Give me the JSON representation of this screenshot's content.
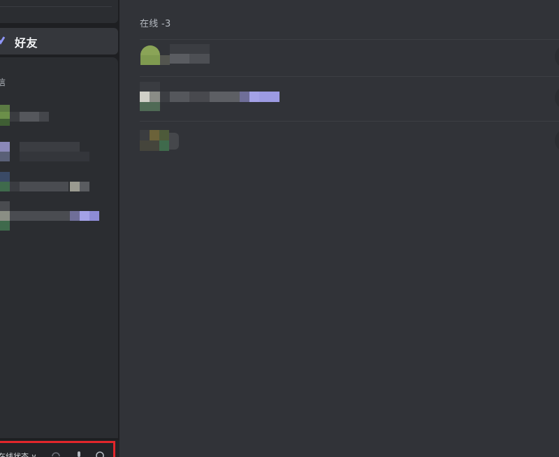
{
  "sidebar": {
    "friends_label": "好友",
    "dm_header": "信",
    "user_name": "在线状态 ∨"
  },
  "main": {
    "online_header": "在线 -3"
  },
  "colors": {
    "background": "#313338",
    "sidebar": "#2b2d31",
    "server_rail": "#1e1f22",
    "accent": "#5865f2",
    "highlight": "#e3262b"
  },
  "icons": {
    "friends": "friends-wave-icon",
    "microphone": "microphone-icon",
    "headphones": "headphones-icon",
    "settings": "settings-icon"
  }
}
